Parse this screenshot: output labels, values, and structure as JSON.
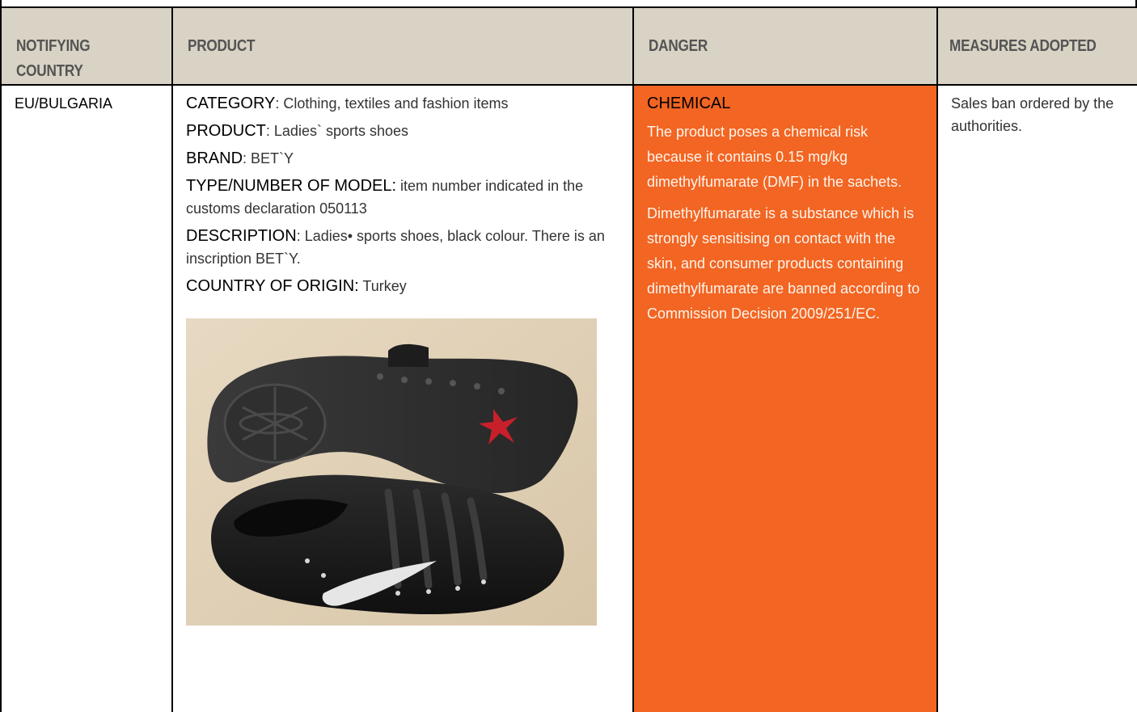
{
  "table": {
    "headers": {
      "country": "NOTIFYING COUNTRY",
      "product": "PRODUCT",
      "danger": "DANGER",
      "measures": "MEASURES ADOPTED"
    },
    "row": {
      "country": "EU/BULGARIA",
      "product": {
        "fields": [
          {
            "label": "CATEGORY",
            "sep": ":",
            "value": " Clothing, textiles and fashion items"
          },
          {
            "label": "PRODUCT",
            "sep": ":",
            "value": " Ladies` sports shoes"
          },
          {
            "label": "BRAND",
            "sep": ":",
            "value": " BET`Y"
          },
          {
            "label": "TYPE/NUMBER OF MODEL:",
            "sep": "",
            "value": " item number indicated in the customs declaration 050113"
          },
          {
            "label": "DESCRIPTION",
            "sep": ":",
            "value": " Ladies• sports shoes, black colour. There is an inscription BET`Y."
          },
          {
            "label": "COUNTRY OF ORIGIN:",
            "sep": "",
            "value": " Turkey"
          }
        ]
      },
      "danger": {
        "title": "CHEMICAL",
        "paragraphs": [
          "The product poses a chemical risk because it contains 0.15 mg/kg dimethylfumarate (DMF) in the sachets.",
          "Dimethylfumarate is a substance which is strongly sensitising on contact with the skin, and consumer products containing dimethylfumarate are banned according to Commission Decision 2009/251/EC."
        ],
        "color": "#f26522"
      },
      "measures": "Sales ban ordered by the authorities."
    }
  },
  "colors": {
    "header_bg": "#d9d3c5",
    "header_text": "#545454"
  }
}
